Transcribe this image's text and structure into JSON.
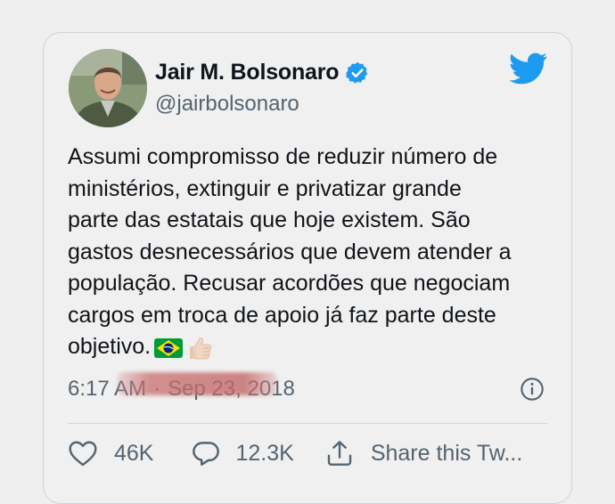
{
  "author": {
    "display_name": "Jair M. Bolsonaro",
    "handle": "@jairbolsonaro",
    "verified": true
  },
  "tweet": {
    "text": "Assumi compromisso de reduzir número de\nministérios, extinguir e privatizar grande\nparte das estatais que hoje existem. São\ngastos desnecessários que devem atender a\npopulação. Recusar acordões que negociam\ncargos em troca de apoio já faz parte deste\nobjetivo.",
    "emojis": [
      "brazil-flag",
      "thumbs-up"
    ],
    "time": "6:17 AM",
    "separator": "·",
    "date": "Sep 23, 2018"
  },
  "actions": {
    "likes": "46K",
    "replies": "12.3K",
    "share_label": "Share this Tw..."
  },
  "icons": {
    "brand": "twitter-bird-icon",
    "info": "info-icon",
    "like": "heart-icon",
    "reply": "reply-icon",
    "share": "share-icon"
  },
  "colors": {
    "accent": "#1d9bf0",
    "text": "#0f1419",
    "secondary": "#536471",
    "background": "#efefef"
  }
}
